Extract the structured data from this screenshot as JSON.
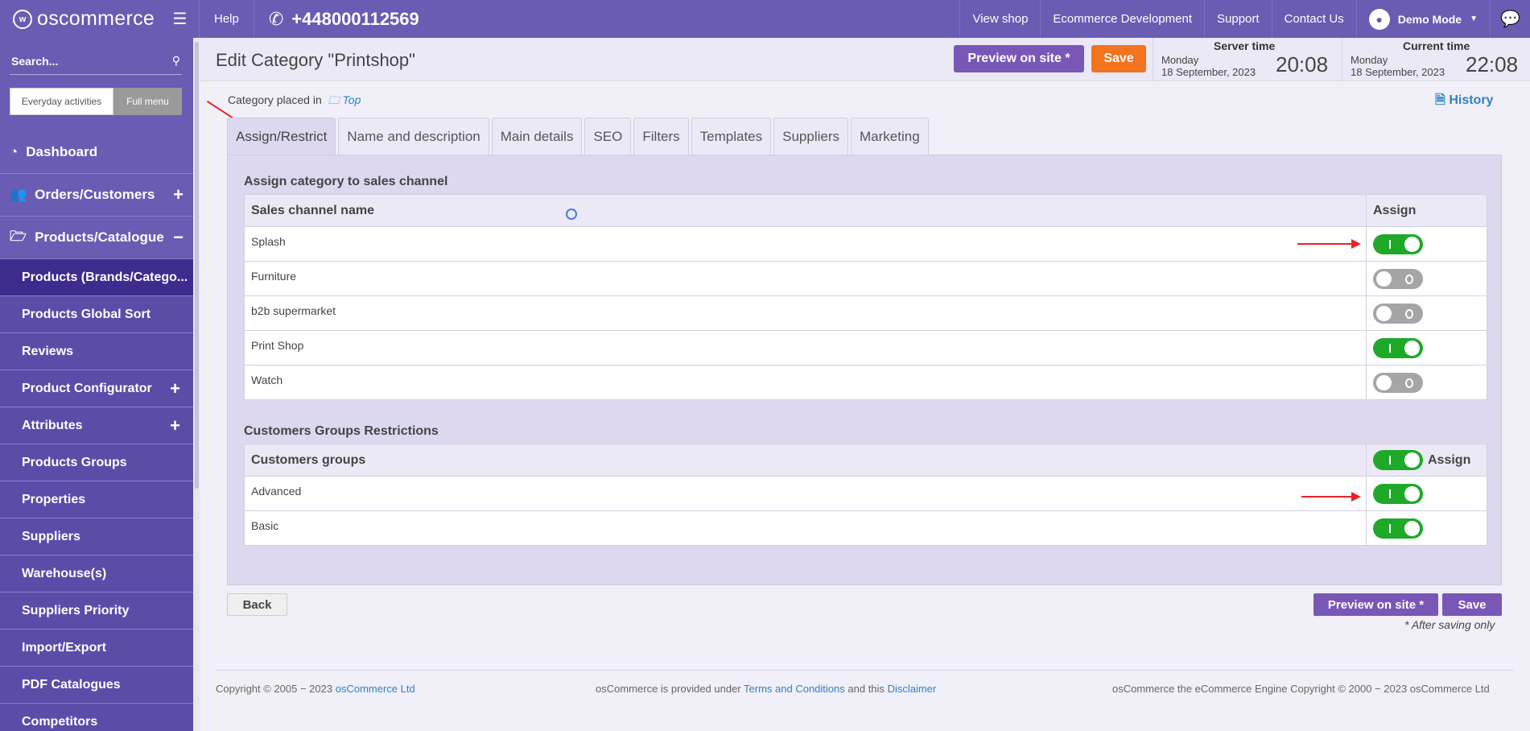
{
  "topbar": {
    "logo_text": "oscommerce",
    "help": "Help",
    "phone": "+448000112569",
    "view_shop": "View shop",
    "ecommerce_dev": "Ecommerce Development",
    "support": "Support",
    "contact": "Contact Us",
    "user": "Demo Mode"
  },
  "sidebar": {
    "search_placeholder": "Search...",
    "mode_everyday": "Everyday activities",
    "mode_full": "Full menu",
    "dashboard": "Dashboard",
    "orders": "Orders/Customers",
    "products": "Products/Catalogue",
    "subitems": [
      "Products (Brands/Catego...",
      "Products Global Sort",
      "Reviews",
      "Product Configurator",
      "Attributes",
      "Products Groups",
      "Properties",
      "Suppliers",
      "Warehouse(s)",
      "Suppliers Priority",
      "Import/Export",
      "PDF Catalogues",
      "Competitors"
    ]
  },
  "header": {
    "title": "Edit Category \"Printshop\"",
    "preview": "Preview on site *",
    "save": "Save",
    "server_label": "Server time",
    "server_day": "Monday",
    "server_date": "18 September, 2023",
    "server_time": "20:08",
    "current_label": "Current time",
    "current_day": "Monday",
    "current_date": "18 September, 2023",
    "current_time": "22:08"
  },
  "main": {
    "placed_in": "Category placed in",
    "placed_top": "Top",
    "history": "History",
    "tabs": [
      "Assign/Restrict",
      "Name and description",
      "Main details",
      "SEO",
      "Filters",
      "Templates",
      "Suppliers",
      "Marketing"
    ],
    "sales_title": "Assign category to sales channel",
    "sales_col": "Sales channel name",
    "assign_col": "Assign",
    "sales_rows": [
      {
        "name": "Splash",
        "on": true
      },
      {
        "name": "Furniture",
        "on": false
      },
      {
        "name": "b2b supermarket",
        "on": false
      },
      {
        "name": "Print Shop",
        "on": true
      },
      {
        "name": "Watch",
        "on": false
      }
    ],
    "groups_title": "Customers Groups Restrictions",
    "groups_col": "Customers groups",
    "groups_assign": "Assign",
    "groups_rows": [
      {
        "name": "Advanced",
        "on": true
      },
      {
        "name": "Basic",
        "on": true
      }
    ],
    "back": "Back",
    "preview": "Preview on site *",
    "save": "Save",
    "note": "* After saving only"
  },
  "footer": {
    "left_prefix": "Copyright © 2005 − 2023",
    "left_link": "osCommerce Ltd",
    "mid_prefix": "osCommerce is provided under",
    "mid_terms": "Terms and Conditions",
    "mid_and": "and this",
    "mid_disclaimer": "Disclaimer",
    "right": "osCommerce the eCommerce Engine Copyright © 2000 − 2023 osCommerce Ltd"
  },
  "colors": {
    "brand": "#6a5bb3",
    "toggle_on": "#1fa929",
    "toggle_off": "#a5a5a5",
    "save_orange": "#f4731e",
    "link": "#2d83c3"
  }
}
